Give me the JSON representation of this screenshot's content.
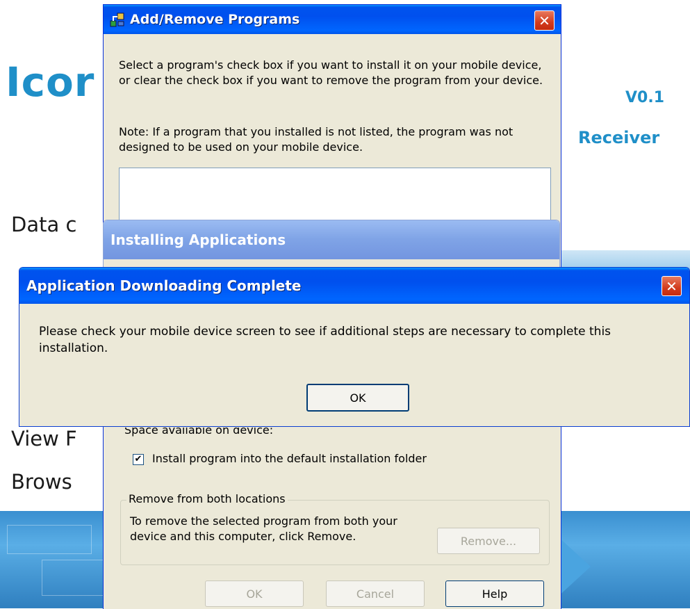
{
  "background_app": {
    "logo_text": "Icor",
    "version": "V0.1",
    "subtitle_fragment": "Receiver",
    "menu_items": [
      "Data c",
      "View F",
      "Brows"
    ]
  },
  "add_remove": {
    "title": "Add/Remove Programs",
    "intro": "Select a program's check box if you want to install it on your mobile device, or clear the check box if you want to remove the program from your device.",
    "note": "Note:  If a program that you installed is not listed, the program was not designed to be used on your mobile device.",
    "space_label": "Space available on device:",
    "install_default_label": "Install program into the default installation folder",
    "install_default_checked": true,
    "remove_group_label": "Remove from both locations",
    "remove_group_text": "To remove the selected program from both your device and this computer, click Remove.",
    "remove_button": "Remove...",
    "ok_button": "OK",
    "cancel_button": "Cancel",
    "help_button": "Help"
  },
  "installing": {
    "title": "Installing Applications"
  },
  "complete_dialog": {
    "title": "Application Downloading Complete",
    "message": "Please check your mobile device screen to see if additional steps are necessary to complete this installation.",
    "ok_button": "OK"
  },
  "icons": {
    "add_remove": "add-remove-programs-icon",
    "close": "close-icon",
    "checkbox": "checkbox-checked-icon"
  },
  "colors": {
    "xp_title_blue": "#0055ea",
    "xp_face": "#ece9d8",
    "close_red": "#d23b1d",
    "brand_blue": "#1f8fc8"
  }
}
